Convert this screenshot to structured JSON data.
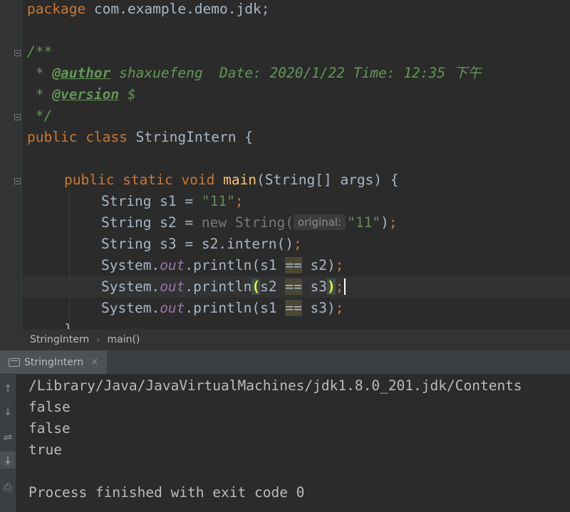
{
  "editor": {
    "lines": {
      "package_kw": "package",
      "package_name": " com.example.demo.jdk;",
      "doc_open": "/**",
      "doc_star1": " * ",
      "author_tag": "@author",
      "author_text": " shaxuefeng  Date: 2020/1/22 Time: 12:35 下午",
      "doc_star2": " * ",
      "version_tag": "@version",
      "version_text": " $",
      "doc_close": " */",
      "public_kw": "public",
      "class_kw": " class",
      "class_name": " StringIntern {",
      "main_public": "public",
      "main_static": " static",
      "main_void": " void",
      "main_name": " main",
      "main_params": "(String[] args) {",
      "s1_decl": "String s1 = ",
      "s1_value": "\"11\"",
      "s1_end": ";",
      "s2_decl": "String s2 = ",
      "s2_new": "new String(",
      "s2_hint": "original:",
      "s2_value": "\"11\"",
      "s2_close": ")",
      "s2_end": ";",
      "s3_decl": "String s3 = s2.intern()",
      "s3_end": ";",
      "print_prefix": "System.",
      "print_out": "out",
      "print_call": ".println(",
      "p1_left": "s1 ",
      "p1_op": "==",
      "p1_right": " s2)",
      "p2_left": "s2 ",
      "p2_op": "==",
      "p2_right": " s3",
      "p3_left": "s1 ",
      "p3_op": "==",
      "p3_right": " s3)",
      "semicolon": ";",
      "paren_open": "(",
      "paren_close": ")",
      "closing_brace": "}"
    }
  },
  "breadcrumb": {
    "items": [
      "StringIntern",
      "main()"
    ],
    "separator": "›"
  },
  "run_panel": {
    "tab_label": "StringIntern",
    "close_glyph": "×",
    "tools": [
      "up-arrow-icon",
      "down-arrow-icon",
      "soft-wrap-icon",
      "scroll-to-end-icon",
      "print-icon"
    ],
    "tool_glyphs": [
      "↑",
      "↓",
      "⇌",
      "⤓",
      "⎙"
    ],
    "output": [
      "/Library/Java/JavaVirtualMachines/jdk1.8.0_201.jdk/Contents",
      "false",
      "false",
      "true",
      "",
      "Process finished with exit code 0"
    ]
  },
  "colors": {
    "background": "#2b2b2b",
    "keyword": "#cc7832",
    "string": "#6a8759",
    "function": "#ffc66d",
    "doc": "#629755",
    "field": "#9876aa"
  }
}
